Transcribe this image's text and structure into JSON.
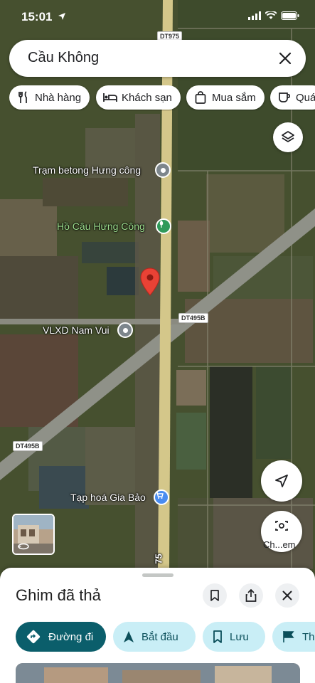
{
  "status_bar": {
    "time": "15:01"
  },
  "search": {
    "query": "Cầu Không"
  },
  "chips": [
    {
      "label": "Nhà hàng",
      "icon": "fork-knife-icon"
    },
    {
      "label": "Khách sạn",
      "icon": "bed-icon"
    },
    {
      "label": "Mua sắm",
      "icon": "shopping-bag-icon"
    },
    {
      "label": "Quá",
      "icon": "coffee-cup-icon"
    }
  ],
  "map": {
    "labels": {
      "betong": "Trạm betong Hưng công",
      "ho_cau": "Hồ Câu Hưng Công",
      "vlxd": "VLXD Nam Vui",
      "tap_hoa": "Tạp hoá Gia Bảo"
    },
    "road_shields": {
      "dt975": "DT975",
      "dt495b_right": "DT495B",
      "dt495b_left": "DT495B",
      "road_75": "75"
    }
  },
  "buttons": {
    "camera_caption": "Ch...em"
  },
  "sheet": {
    "title": "Ghim đã thả",
    "actions": {
      "directions": "Đường đi",
      "start": "Bắt đầu",
      "save": "Lưu",
      "more": "Th"
    }
  },
  "colors": {
    "primary_action": "#0b5e6b",
    "tonal_action": "#c9eef6",
    "pin": "#e94235"
  }
}
